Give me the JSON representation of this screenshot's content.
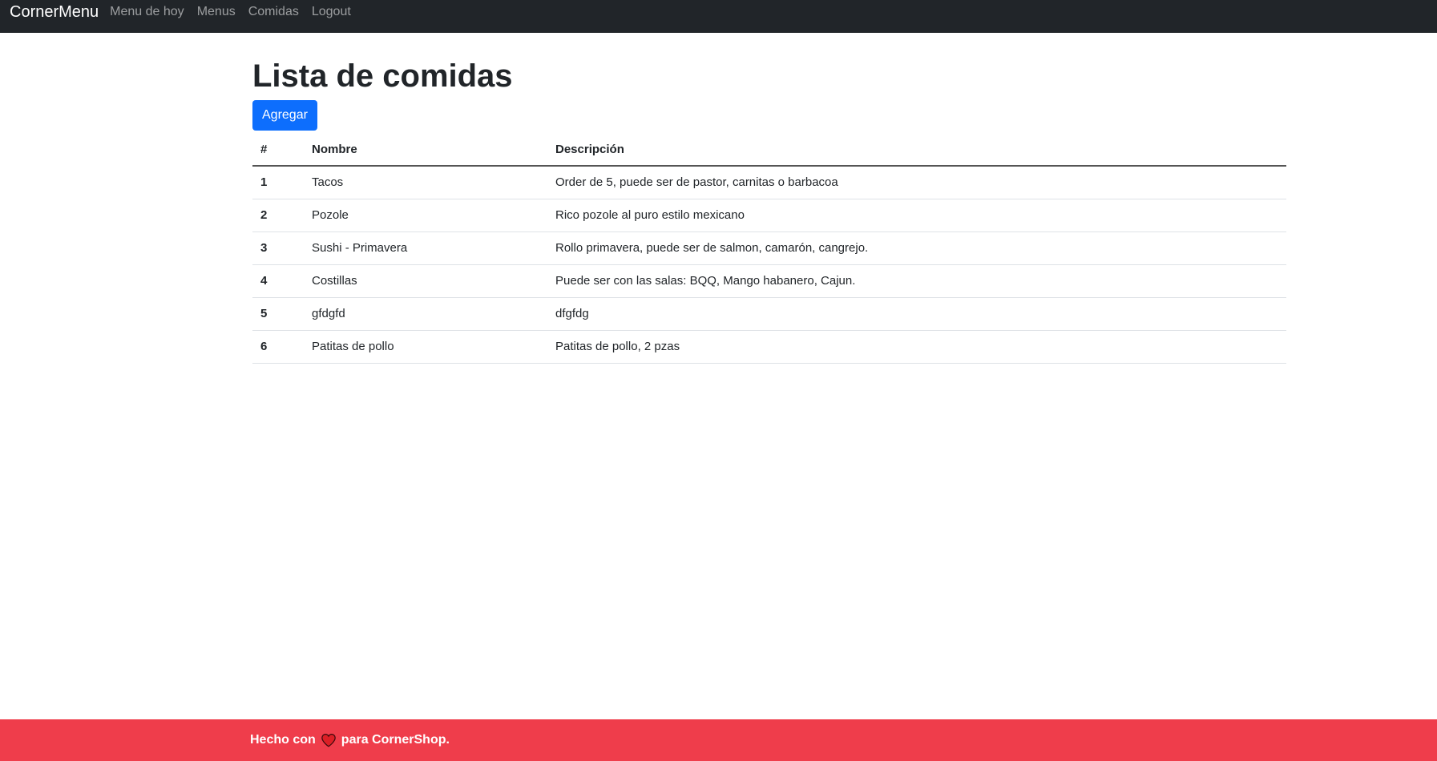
{
  "navbar": {
    "brand": "CornerMenu",
    "links": [
      "Menu de hoy",
      "Menus",
      "Comidas",
      "Logout"
    ]
  },
  "main": {
    "title": "Lista de comidas",
    "add_button": "Agregar",
    "table": {
      "headers": [
        "#",
        "Nombre",
        "Descripción"
      ],
      "rows": [
        [
          "1",
          "Tacos",
          "Order de 5, puede ser de pastor, carnitas o barbacoa"
        ],
        [
          "2",
          "Pozole",
          "Rico pozole al puro estilo mexicano"
        ],
        [
          "3",
          "Sushi - Primavera",
          "Rollo primavera, puede ser de salmon, camarón, cangrejo."
        ],
        [
          "4",
          "Costillas",
          "Puede ser con las salas: BQQ, Mango habanero, Cajun."
        ],
        [
          "5",
          "gfdgfd",
          "dfgfdg"
        ],
        [
          "6",
          "Patitas de pollo",
          "Patitas de pollo, 2 pzas"
        ]
      ]
    }
  },
  "footer": {
    "text_before": "Hecho con",
    "icon": "heart-icon",
    "text_after": "para CornerShop."
  },
  "colors": {
    "navbar_bg": "#212529",
    "button_primary": "#0d6efd",
    "footer_bg": "#ef3d4b",
    "heart": "#dc1f26"
  }
}
